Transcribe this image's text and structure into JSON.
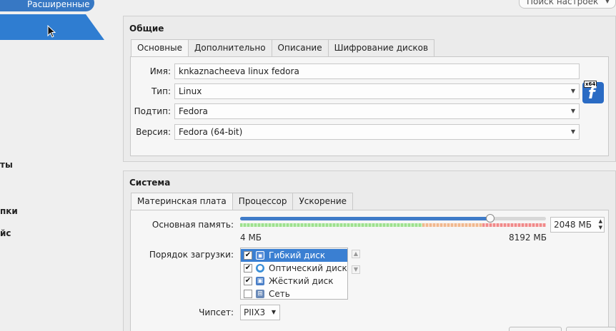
{
  "sidebar": {
    "active_item_label": "Расширенные",
    "partial_labels": [
      "ты",
      "пки",
      "йс"
    ]
  },
  "search": {
    "placeholder": "Поиск настроек"
  },
  "general": {
    "title": "Общие",
    "tabs": [
      "Основные",
      "Дополнительно",
      "Описание",
      "Шифрование дисков"
    ],
    "active_tab": "Основные",
    "fields": {
      "name_label": "Имя:",
      "name_value": "knkaznacheeva linux fedora",
      "type_label": "Тип:",
      "type_value": "Linux",
      "subtype_label": "Подтип:",
      "subtype_value": "Fedora",
      "version_label": "Версия:",
      "version_value": "Fedora (64-bit)"
    },
    "os_icon": {
      "name": "fedora-64-icon",
      "badge": "x64",
      "glyph": "f"
    }
  },
  "system": {
    "title": "Система",
    "tabs": [
      "Материнская плата",
      "Процессор",
      "Ускорение"
    ],
    "active_tab": "Материнская плата",
    "memory": {
      "label": "Основная память:",
      "min_label": "4 МБ",
      "max_label": "8192 МБ",
      "value_text": "2048 МБ",
      "value_mb": 2048,
      "min_mb": 4,
      "max_mb": 8192
    },
    "boot_order": {
      "label": "Порядок загрузки:",
      "items": [
        {
          "label": "Гибкий диск",
          "checked": true,
          "icon": "floppy-icon",
          "selected": true
        },
        {
          "label": "Оптический диск",
          "checked": true,
          "icon": "optical-disc-icon",
          "selected": false
        },
        {
          "label": "Жёсткий диск",
          "checked": true,
          "icon": "hard-disk-icon",
          "selected": false
        },
        {
          "label": "Сеть",
          "checked": false,
          "icon": "network-icon",
          "selected": false
        }
      ]
    },
    "chipset": {
      "label": "Чипсет:",
      "value": "PIIX3"
    }
  },
  "colors": {
    "accent": "#3778c4",
    "selection": "#3a7fd2",
    "os_icon_bg": "#2a6bc4"
  }
}
